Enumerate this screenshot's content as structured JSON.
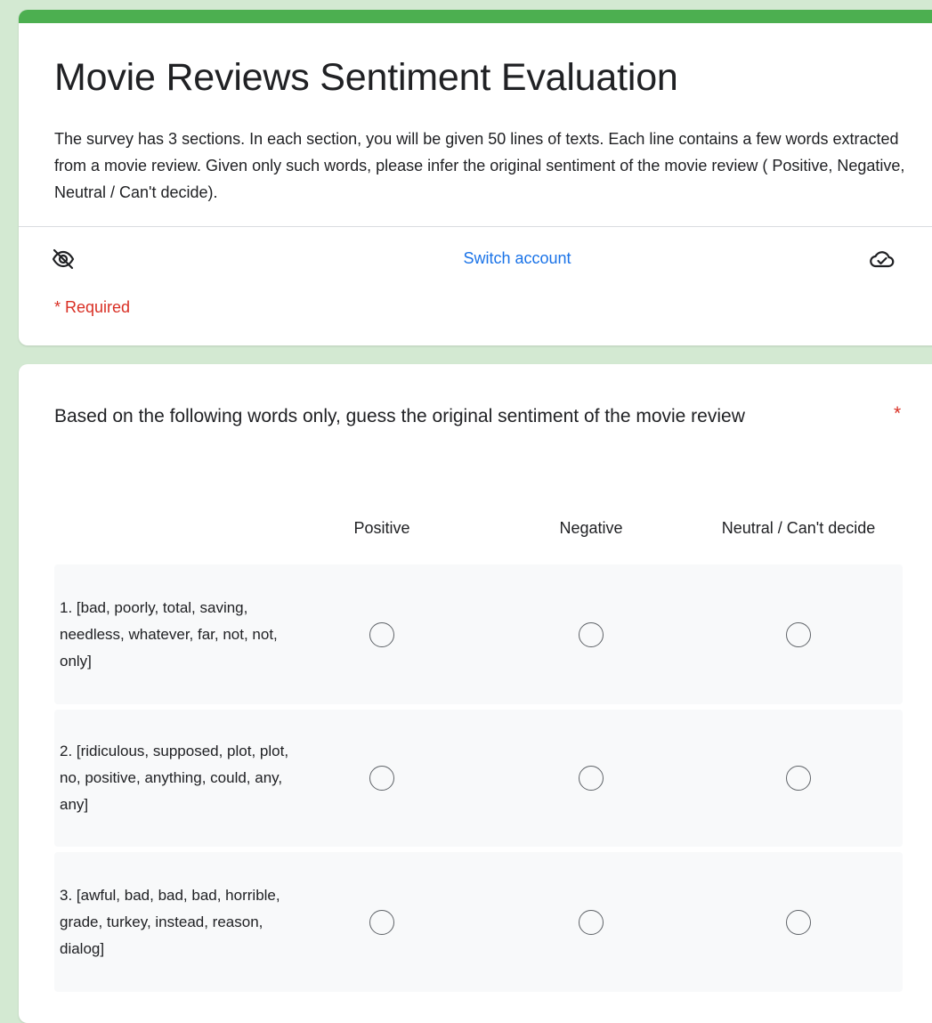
{
  "form": {
    "title": "Movie Reviews Sentiment Evaluation",
    "description": "The survey has 3 sections. In each section, you will be given 50 lines of texts. Each line contains a few words extracted from a movie review. Given only such words, please infer the original sentiment of the movie review ( Positive,  Negative,  Neutral / Can't decide).",
    "switch_account_label": "Switch account",
    "required_note": "* Required",
    "icons": {
      "not_shared": "eye-off-icon",
      "saved": "cloud-check-icon"
    },
    "colors": {
      "background": "#d3e9d2",
      "accent": "#4caf50",
      "link": "#1a73e8",
      "required": "#d93025"
    }
  },
  "question": {
    "title": "Based on the following words only, guess the original sentiment of the movie review",
    "required_marker": "*",
    "columns": [
      "Positive",
      "Negative",
      "Neutral / Can't decide"
    ],
    "rows": [
      {
        "label": "1. [bad, poorly, total, saving, needless, whatever, far, not, not, only]",
        "selected": null
      },
      {
        "label": "2. [ridiculous, supposed, plot, plot, no, positive, anything, could, any, any]",
        "selected": null
      },
      {
        "label": "3. [awful, bad, bad, bad, horrible, grade, turkey, instead, reason, dialog]",
        "selected": null
      }
    ]
  }
}
